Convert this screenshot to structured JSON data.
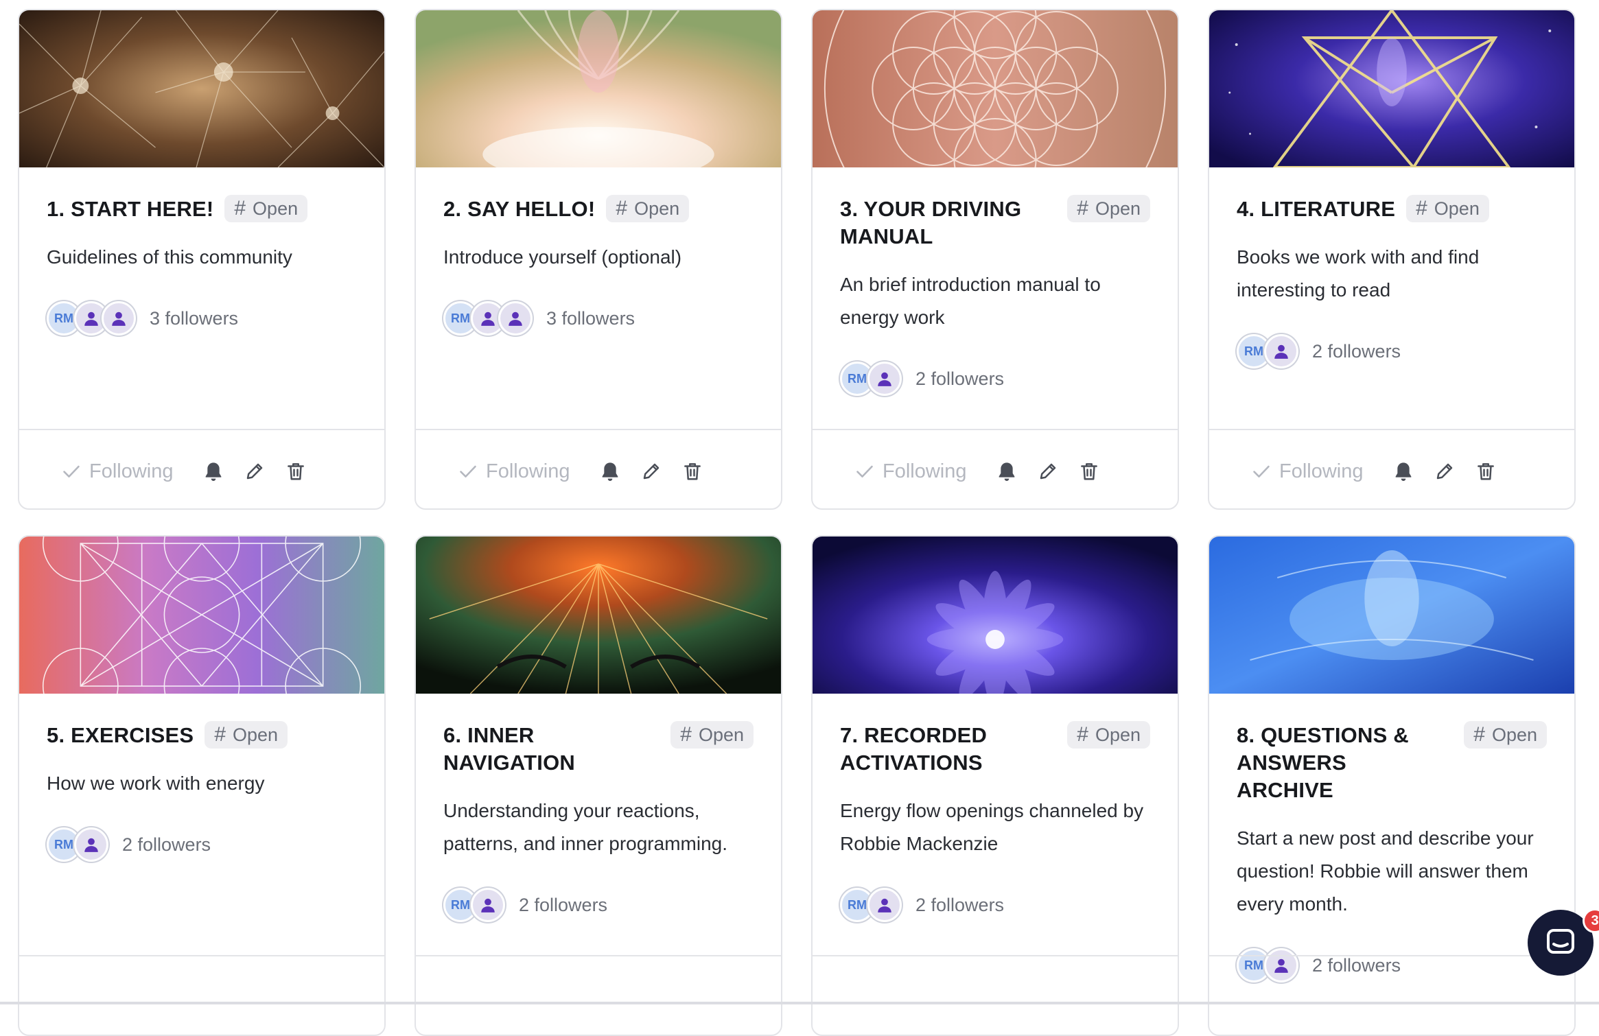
{
  "open_label": "Open",
  "following_label": "Following",
  "avatar_initials": "RM",
  "chat_badge_count": "3",
  "cards": [
    {
      "title": "1. START HERE!",
      "description": "Guidelines of this community",
      "followers": "3 followers"
    },
    {
      "title": "2. SAY HELLO!",
      "description": "Introduce yourself (optional)",
      "followers": "3 followers"
    },
    {
      "title": "3. YOUR DRIVING MANUAL",
      "description": "An brief introduction manual to energy work",
      "followers": "2 followers"
    },
    {
      "title": "4. LITERATURE",
      "description": "Books we work with and find interesting to read",
      "followers": "2 followers"
    },
    {
      "title": "5. EXERCISES",
      "description": "How we work with energy",
      "followers": "2 followers"
    },
    {
      "title": "6. INNER NAVIGATION",
      "description": "Understanding your reactions, patterns, and inner programming.",
      "followers": "2 followers"
    },
    {
      "title": "7. RECORDED ACTIVATIONS",
      "description": "Energy flow openings channeled by Robbie Mackenzie",
      "followers": "2 followers"
    },
    {
      "title": "8. QUESTIONS & ANSWERS ARCHIVE",
      "description": "Start a new post and describe your question! Robbie will answer them every month.",
      "followers": "2 followers"
    }
  ]
}
